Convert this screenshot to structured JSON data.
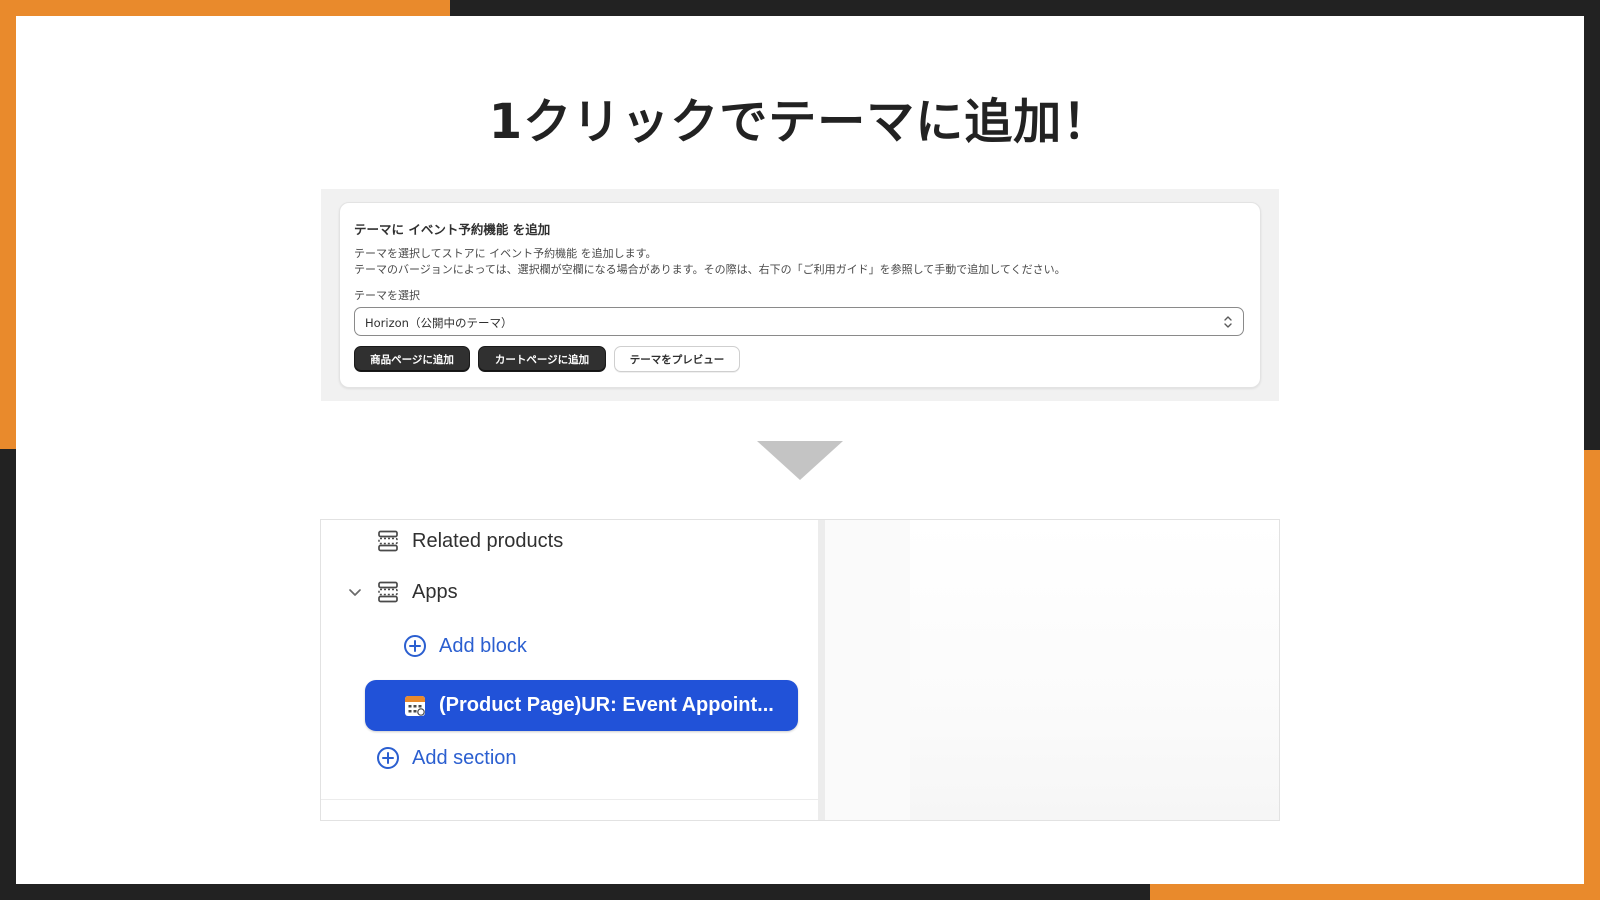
{
  "slide": {
    "title": "1クリックでテーマに追加！",
    "colors": {
      "accent": "#E98A2C",
      "frame": "#222222",
      "primary_blue": "#2152D8"
    }
  },
  "install_card": {
    "title": "テーマに イベント予約機能 を追加",
    "description_line1": "テーマを選択してストアに イベント予約機能 を追加します。",
    "description_line2": "テーマのバージョンによっては、選択欄が空欄になる場合があります。その際は、右下の「ご利用ガイド」を参照して手動で追加してください。",
    "select_label": "テーマを選択",
    "selected_theme": "Horizon（公開中のテーマ）",
    "buttons": {
      "add_product_page": "商品ページに追加",
      "add_cart_page": "カートページに追加",
      "preview_theme": "テーマをプレビュー"
    }
  },
  "theme_editor": {
    "items": {
      "related_products": "Related products",
      "apps": "Apps",
      "add_block": "Add block",
      "app_block": "(Product Page)UR: Event Appoint...",
      "add_section": "Add section"
    },
    "icons": {
      "section": "section-icon",
      "chevron": "chevron-down-icon",
      "add": "plus-circle-icon",
      "app": "calendar-app-icon"
    }
  }
}
